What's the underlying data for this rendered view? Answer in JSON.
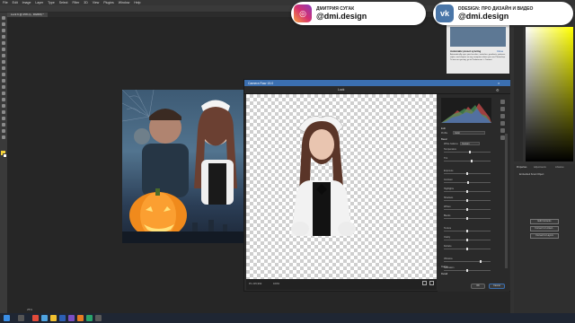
{
  "app": {
    "menu": [
      "File",
      "Edit",
      "Image",
      "Layer",
      "Type",
      "Select",
      "Filter",
      "3D",
      "View",
      "Plugins",
      "Window",
      "Help"
    ],
    "doc_tab": "Luck 6 @ 25% (L, RGB/8) *"
  },
  "social": {
    "instagram": {
      "title": "ДМИТРИЯ СУГАК",
      "handle": "@dmi.design"
    },
    "vk": {
      "title": "DDESIGN: ПРО ДИЗАЙН И ВИДЕО",
      "handle": "@dmi.design"
    }
  },
  "notification": {
    "title": "Automatic preset syncing",
    "action": "Close",
    "body": "Automatically sync your brushes, swatches, gradients, patterns, styles, and shapes on any computer where you use Photoshop. To turn on syncing, go to Preferences > Content."
  },
  "camera_raw": {
    "title": "Camera Raw 15.0",
    "file": "Luck",
    "edit_label": "Edit",
    "profile": {
      "label": "Profile",
      "value": "Color"
    },
    "basic_label": "Basic",
    "white_balance": {
      "label": "White balance",
      "value": "Custom"
    },
    "sliders": [
      {
        "label": "Temperature",
        "value": 0.55
      },
      {
        "label": "Tint",
        "value": 0.6
      },
      {
        "label": "Exposure",
        "value": 0.5
      },
      {
        "label": "Contrast",
        "value": 0.52
      },
      {
        "label": "Highlights",
        "value": 0.5
      },
      {
        "label": "Shadows",
        "value": 0.5
      },
      {
        "label": "Whites",
        "value": 0.5
      },
      {
        "label": "Blacks",
        "value": 0.5
      },
      {
        "label": "Texture",
        "value": 0.5
      },
      {
        "label": "Clarity",
        "value": 0.5
      },
      {
        "label": "Dehaze",
        "value": 0.5
      },
      {
        "label": "Vibrance",
        "value": 0.78
      },
      {
        "label": "Saturation",
        "value": 0.5
      }
    ],
    "sections": [
      "Curve",
      "Detail"
    ],
    "zoom": "100%",
    "file_info": "P1 215,992",
    "ok": "OK",
    "cancel": "Cancel"
  },
  "right_panel": {
    "tabs": [
      "Properties",
      "Adjustments",
      "Libraries"
    ],
    "layer_label": "Embedded Smart Object",
    "buttons": [
      "Edit Contents",
      "Convert to Linked...",
      "Convert to Layers"
    ]
  },
  "status": {
    "zoom": "25%"
  },
  "colors": {
    "dialog_title": "#3b6fb0",
    "instagram": "#d6306f",
    "vk": "#4a76a8"
  }
}
